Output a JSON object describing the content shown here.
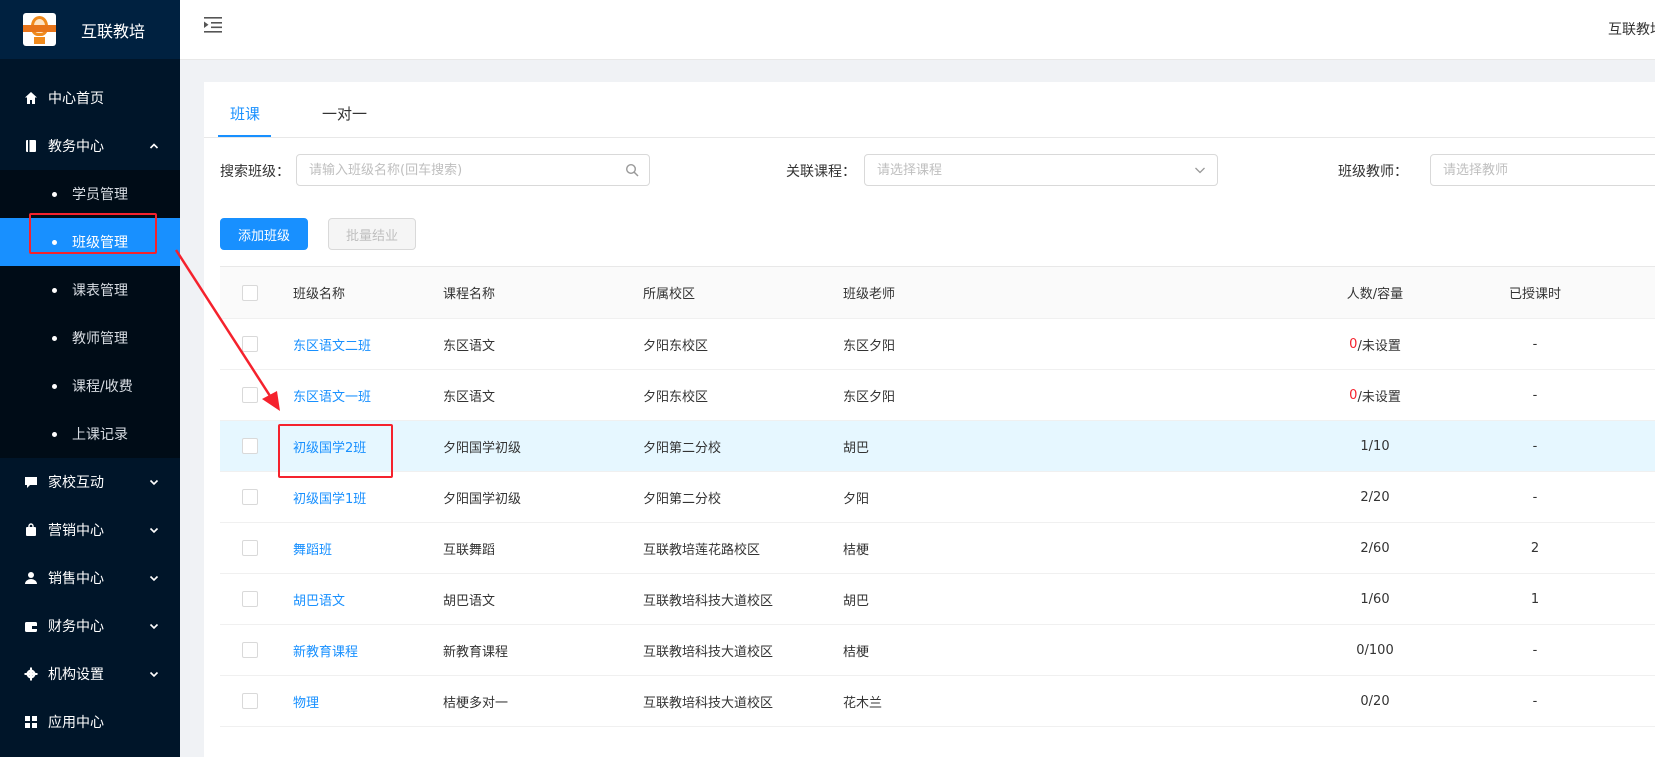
{
  "app": {
    "title": "互联教培"
  },
  "sidebar": {
    "items": [
      {
        "label": "中心首页",
        "icon": "home-icon"
      },
      {
        "label": "教务中心",
        "icon": "book-icon",
        "expanded": true,
        "children": [
          {
            "label": "学员管理"
          },
          {
            "label": "班级管理",
            "active": true
          },
          {
            "label": "课表管理"
          },
          {
            "label": "教师管理"
          },
          {
            "label": "课程/收费"
          },
          {
            "label": "上课记录"
          }
        ]
      },
      {
        "label": "家校互动",
        "icon": "chat-icon"
      },
      {
        "label": "营销中心",
        "icon": "bag-icon"
      },
      {
        "label": "销售中心",
        "icon": "user-icon"
      },
      {
        "label": "财务中心",
        "icon": "wallet-icon"
      },
      {
        "label": "机构设置",
        "icon": "gear-icon"
      },
      {
        "label": "应用中心",
        "icon": "grid-icon"
      }
    ]
  },
  "header": {
    "right_text": "互联教培"
  },
  "tabs": [
    {
      "label": "班课",
      "active": true
    },
    {
      "label": "一对一"
    }
  ],
  "filters": {
    "search_label": "搜索班级：",
    "search_placeholder": "请输入班级名称(回车搜索)",
    "course_label": "关联课程：",
    "course_placeholder": "请选择课程",
    "teacher_label": "班级教师：",
    "teacher_placeholder": "请选择教师"
  },
  "actions": {
    "add_label": "添加班级",
    "batch_label": "批量结业"
  },
  "table": {
    "headers": {
      "name": "班级名称",
      "course": "课程名称",
      "campus": "所属校区",
      "teacher": "班级老师",
      "count": "人数/容量",
      "hours": "已授课时"
    },
    "rows": [
      {
        "name": "东区语文二班",
        "course": "东区语文",
        "campus": "夕阳东校区",
        "teacher": "东区夕阳",
        "count": "0",
        "capacity": "/未设置",
        "count_red": true,
        "hours": "-"
      },
      {
        "name": "东区语文一班",
        "course": "东区语文",
        "campus": "夕阳东校区",
        "teacher": "东区夕阳",
        "count": "0",
        "capacity": "/未设置",
        "count_red": true,
        "hours": "-"
      },
      {
        "name": "初级国学2班",
        "course": "夕阳国学初级",
        "campus": "夕阳第二分校",
        "teacher": "胡巴",
        "count": "1",
        "capacity": "/10",
        "count_red": false,
        "hours": "-",
        "highlight": true
      },
      {
        "name": "初级国学1班",
        "course": "夕阳国学初级",
        "campus": "夕阳第二分校",
        "teacher": "夕阳",
        "count": "2",
        "capacity": "/20",
        "count_red": false,
        "hours": "-"
      },
      {
        "name": "舞蹈班",
        "course": "互联舞蹈",
        "campus": "互联教培莲花路校区",
        "teacher": "桔梗",
        "count": "2",
        "capacity": "/60",
        "count_red": false,
        "hours": "2"
      },
      {
        "name": "胡巴语文",
        "course": "胡巴语文",
        "campus": "互联教培科技大道校区",
        "teacher": "胡巴",
        "count": "1",
        "capacity": "/60",
        "count_red": false,
        "hours": "1"
      },
      {
        "name": "新教育课程",
        "course": "新教育课程",
        "campus": "互联教培科技大道校区",
        "teacher": "桔梗",
        "count": "0",
        "capacity": "/100",
        "count_red": false,
        "hours": "-"
      },
      {
        "name": "物理",
        "course": "桔梗多对一",
        "campus": "互联教培科技大道校区",
        "teacher": "花木兰",
        "count": "0",
        "capacity": "/20",
        "count_red": false,
        "hours": "-"
      }
    ]
  },
  "colors": {
    "primary": "#1890ff",
    "sidebar_bg": "#001529",
    "annotation": "#f5222d"
  }
}
